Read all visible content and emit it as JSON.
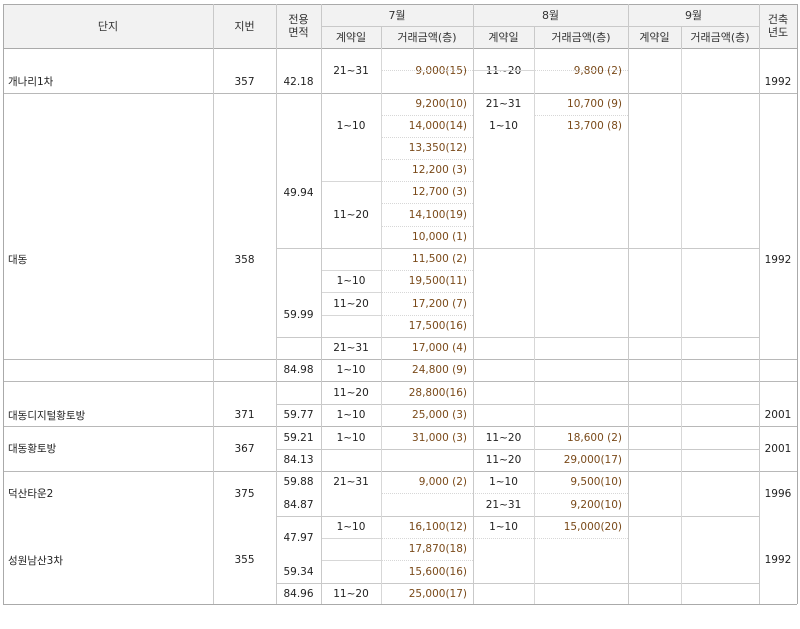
{
  "header": {
    "complex": "단지",
    "lot": "지번",
    "area": "전용\n면적",
    "built": "건축\n년도",
    "months": [
      "7월",
      "8월",
      "9월"
    ],
    "date": "계약일",
    "amount": "거래금액(층)"
  },
  "complexes": [
    {
      "name": "개나리1차",
      "lot": "357",
      "built": "1992"
    },
    {
      "name": "대동",
      "lot": "358",
      "built": "1992"
    },
    {
      "name": "대동디지털황토방",
      "lot": "371",
      "built": "2001"
    },
    {
      "name": "대동황토방",
      "lot": "367",
      "built": "2001"
    },
    {
      "name": "덕산타운2",
      "lot": "375",
      "built": "1996"
    },
    {
      "name": "성원남산3차",
      "lot": "355",
      "built": "1992"
    }
  ],
  "areas": [
    "42.18",
    "49.94",
    "59.99",
    "84.98",
    "59.77",
    "59.21",
    "84.13",
    "59.88",
    "84.87",
    "47.97",
    "59.34",
    "84.96"
  ],
  "july": [
    {
      "date": "21~31",
      "amount": "9,000(15)"
    },
    {
      "date": "",
      "amount": "9,200(10)"
    },
    {
      "date": "1~10",
      "amount": "14,000(14)"
    },
    {
      "date": "",
      "amount": "13,350(12)"
    },
    {
      "date": "",
      "amount": "12,200 (3)"
    },
    {
      "date": "",
      "amount": "12,700 (3)"
    },
    {
      "date": "11~20",
      "amount": "14,100(19)"
    },
    {
      "date": "",
      "amount": "10,000 (1)"
    },
    {
      "date": "",
      "amount": "11,500 (2)"
    },
    {
      "date": "1~10",
      "amount": "19,500(11)"
    },
    {
      "date": "11~20",
      "amount": "17,200 (7)"
    },
    {
      "date": "",
      "amount": "17,500(16)"
    },
    {
      "date": "21~31",
      "amount": "17,000 (4)"
    },
    {
      "date": "1~10",
      "amount": "24,800 (9)"
    },
    {
      "date": "11~20",
      "amount": "28,800(16)"
    },
    {
      "date": "1~10",
      "amount": "25,000 (3)"
    },
    {
      "date": "1~10",
      "amount": "31,000 (3)"
    },
    {
      "date": "21~31",
      "amount": "9,000 (2)"
    },
    {
      "date": "1~10",
      "amount": "16,100(12)"
    },
    {
      "date": "",
      "amount": "17,870(18)"
    },
    {
      "date": "",
      "amount": "15,600(16)"
    },
    {
      "date": "11~20",
      "amount": "25,000(17)"
    }
  ],
  "august": [
    {
      "date": "11~20",
      "amount": "9,800 (2)"
    },
    {
      "date": "21~31",
      "amount": "10,700 (9)"
    },
    {
      "date": "1~10",
      "amount": "13,700 (8)"
    },
    {
      "date": "11~20",
      "amount": "18,600 (2)"
    },
    {
      "date": "11~20",
      "amount": "29,000(17)"
    },
    {
      "date": "1~10",
      "amount": "9,500(10)"
    },
    {
      "date": "21~31",
      "amount": "9,200(10)"
    },
    {
      "date": "1~10",
      "amount": "15,000(20)"
    }
  ]
}
